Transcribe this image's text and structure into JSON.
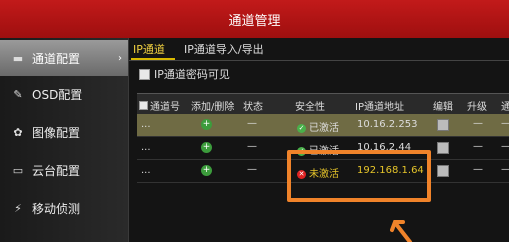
{
  "window": {
    "title": "通道管理"
  },
  "sidebar": {
    "items": [
      {
        "label": "通道配置",
        "icon": "camera-icon",
        "active": true
      },
      {
        "label": "OSD配置",
        "icon": "osd-icon",
        "active": false
      },
      {
        "label": "图像配置",
        "icon": "image-icon",
        "active": false
      },
      {
        "label": "云台配置",
        "icon": "ptz-icon",
        "active": false
      },
      {
        "label": "移动侦测",
        "icon": "motion-icon",
        "active": false
      }
    ]
  },
  "tabs": [
    {
      "label": "IP通道",
      "active": true
    },
    {
      "label": "IP通道导入/导出",
      "active": false
    }
  ],
  "password_visible": {
    "label": "IP通道密码可见"
  },
  "table": {
    "columns": [
      "通道号",
      "添加/删除",
      "状态",
      "安全性",
      "IP通道地址",
      "编辑",
      "升级",
      "通"
    ],
    "rows": [
      {
        "channel": "...",
        "status": "—",
        "security": "已激活",
        "security_state": "ok",
        "ip": "10.16.2.253",
        "upgrade": "—",
        "extra": "—"
      },
      {
        "channel": "...",
        "status": "—",
        "security": "已激活",
        "security_state": "ok",
        "ip": "10.16.2.44",
        "upgrade": "—",
        "extra": "—"
      },
      {
        "channel": "...",
        "status": "—",
        "security": "未激活",
        "security_state": "bad",
        "ip": "192.168.1.64",
        "upgrade": "—",
        "extra": "—"
      }
    ]
  },
  "colors": {
    "title_bar": "#b01414",
    "highlight": "#f0832a",
    "inactive_text": "#e6c52a"
  }
}
